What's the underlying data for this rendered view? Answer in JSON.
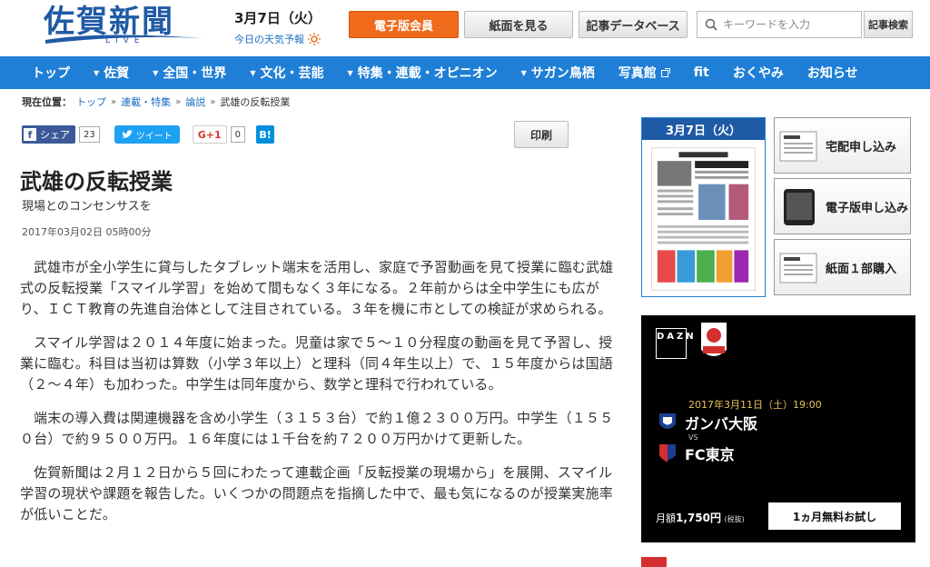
{
  "header": {
    "logo_text": "佐賀新聞",
    "logo_sub": "LIVE",
    "date": "3月7日（火）",
    "weather_link": "今日の天気予報",
    "btn_member": "電子版会員",
    "btn_paper": "紙面を見る",
    "btn_database": "記事データベース",
    "search_placeholder": "キーワードを入力",
    "search_button": "記事検索",
    "accent_orange": "#f06a1c",
    "brand_blue": "#1f5aa6"
  },
  "nav": {
    "items": [
      {
        "label": "トップ"
      },
      {
        "label": "佐賀"
      },
      {
        "label": "全国・世界"
      },
      {
        "label": "文化・芸能"
      },
      {
        "label": "特集・連載・オピニオン"
      },
      {
        "label": "サガン鳥栖"
      },
      {
        "label": "写真館"
      },
      {
        "label": "fit"
      },
      {
        "label": "おくやみ"
      },
      {
        "label": "お知らせ"
      }
    ],
    "color": "#1f7fd6"
  },
  "breadcrumb": {
    "label": "現在位置：",
    "items": [
      "トップ",
      "連載・特集",
      "論説",
      "武雄の反転授業"
    ]
  },
  "social": {
    "facebook": "シェア",
    "facebook_count": "23",
    "twitter": "ツイート",
    "google": "G+1",
    "google_count": "0",
    "hatena": "B!",
    "print": "印刷"
  },
  "article": {
    "title": "武雄の反転授業",
    "subtitle": "現場とのコンセンサスを",
    "datetime": "2017年03月02日 05時00分",
    "paragraphs": [
      "武雄市が全小学生に貸与したタブレット端末を活用し、家庭で予習動画を見て授業に臨む武雄式の反転授業「スマイル学習」を始めて間もなく３年になる。２年前からは全中学生にも広がり、ＩＣＴ教育の先進自治体として注目されている。３年を機に市としての検証が求められる。",
      "スマイル学習は２０１４年度に始まった。児童は家で５～１０分程度の動画を見て予習し、授業に臨む。科目は当初は算数（小学３年以上）と理科（同４年生以上）で、１５年度からは国語（２～４年）も加わった。中学生は同年度から、数学と理科で行われている。",
      "端末の導入費は関連機器を含め小学生（３１５３台）で約１億２３００万円。中学生（１５５０台）で約９５００万円。１６年度には１千台を約７２００万円かけて更新した。",
      "佐賀新聞は２月１２日から５回にわたって連載企画「反転授業の現場から」を展開、スマイル学習の現状や課題を報告した。いくつかの問題点を指摘した中で、最も気になるのが授業実施率が低いことだ。"
    ]
  },
  "sidebar": {
    "paper_date": "3月7日（火）",
    "buttons": [
      {
        "label": "宅配申し込み"
      },
      {
        "label": "電子版申し込み"
      },
      {
        "label": "紙面１部購入"
      }
    ]
  },
  "dazn": {
    "logo": "DAZN",
    "match_date": "2017年3月11日（土）19:00",
    "team1": "ガンバ大阪",
    "vs": "VS",
    "team2": "FC東京",
    "price": "1,750円",
    "price_prefix": "月額",
    "tax": "(税抜)",
    "trial": "1ヵ月無料お試し"
  }
}
